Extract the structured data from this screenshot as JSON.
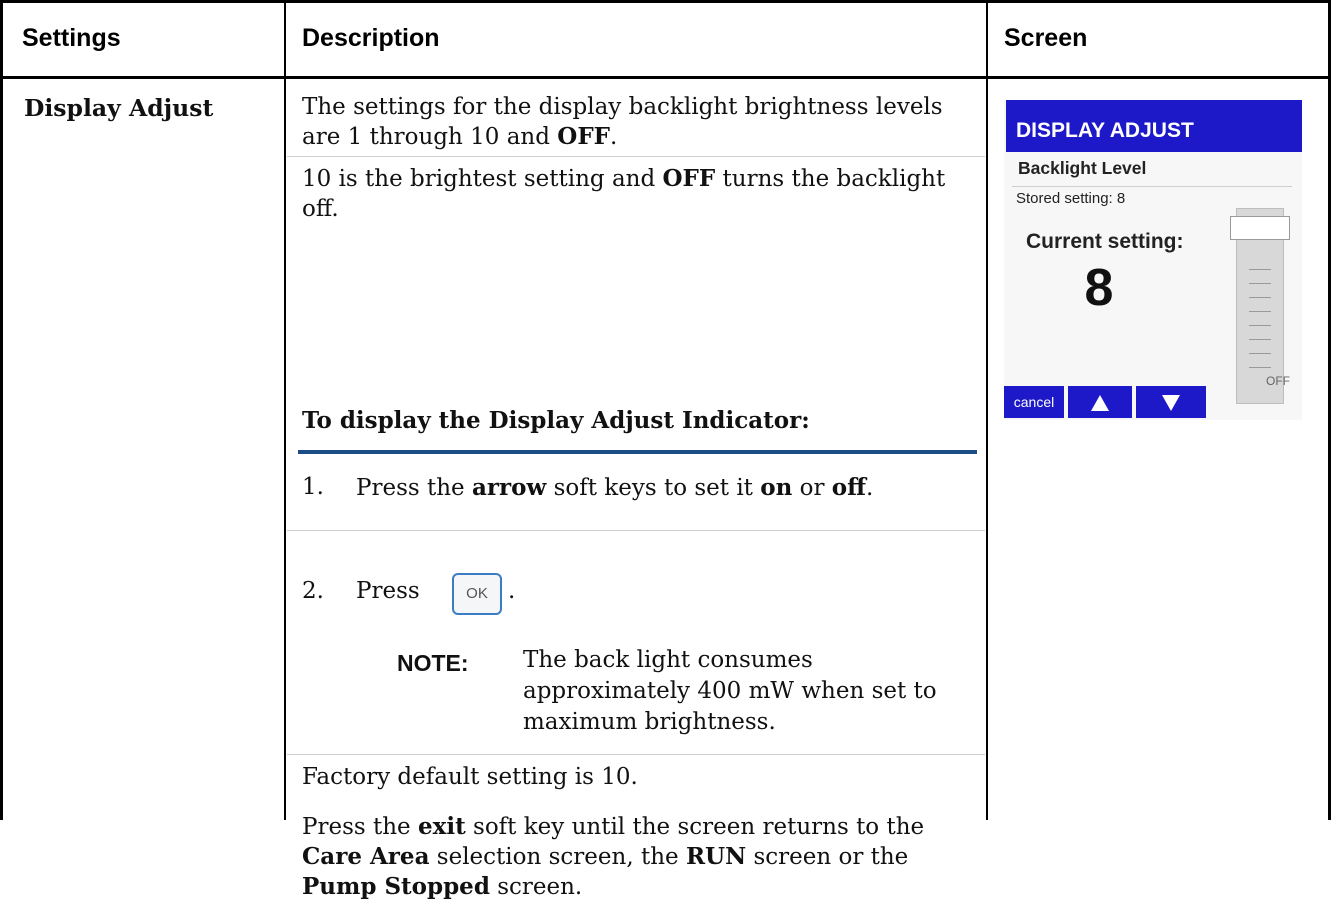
{
  "headers": {
    "settings": "Settings",
    "description": "Description",
    "screen": "Screen"
  },
  "setting_name": "Display Adjust",
  "description": {
    "para1_a": "The settings for the display backlight brightness levels are 1 through 10 and ",
    "para1_b": "OFF",
    "para1_c": ".",
    "para2_a": "10 is the brightest setting and ",
    "para2_b": "OFF",
    "para2_c": " turns the backlight off.",
    "procedure_title": "To display the Display Adjust Indicator:",
    "step1_num": "1.",
    "step1_a": "Press the ",
    "step1_b": "arrow",
    "step1_c": " soft keys to set it ",
    "step1_d": "on",
    "step1_e": " or ",
    "step1_f": "off",
    "step1_g": ".",
    "step2_num": "2.",
    "step2_text": "Press",
    "step2_end": ".",
    "ok_key": "OK",
    "note_label": "NOTE:",
    "note_text": "The back light consumes approximately 400 mW when set to maximum brightness.",
    "factory_default": "Factory default setting is 10.",
    "exit_a": "Press the ",
    "exit_b": "exit",
    "exit_c": " soft key until the screen returns to the ",
    "exit_d": "Care Area",
    "exit_e": " selection screen, the ",
    "exit_f": "RUN",
    "exit_g": " screen or the ",
    "exit_h": "Pump Stopped",
    "exit_i": " screen."
  },
  "device_screen": {
    "title": "DISPLAY ADJUST",
    "subtitle": "Backlight Level",
    "stored": "Stored setting: 8",
    "current_label": "Current setting:",
    "current_value": "8",
    "slider_bottom_label": "OFF",
    "slider_level": 8,
    "slider_max": 10,
    "softkeys": [
      "cancel",
      "up-arrow-icon",
      "down-arrow-icon"
    ],
    "accent": "#1d18c8"
  }
}
